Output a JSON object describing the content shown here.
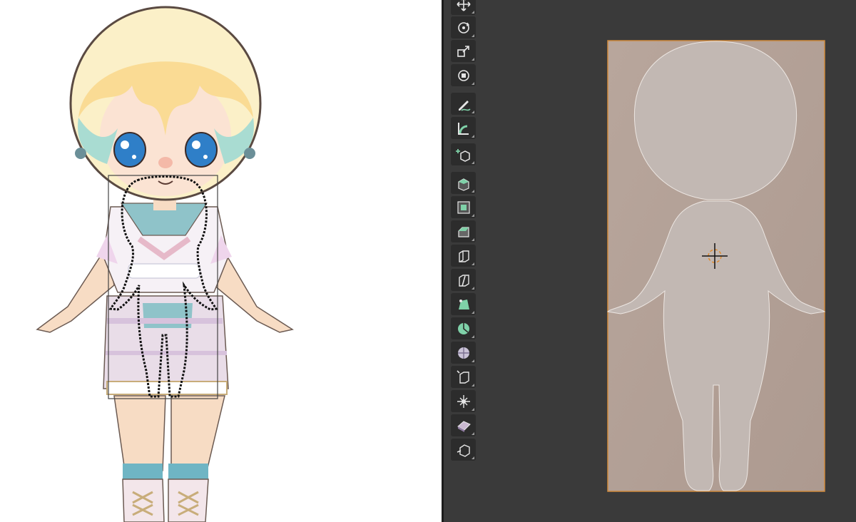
{
  "window": {
    "left_panel": "reference-image-canvas",
    "right_panel": "3d-viewport"
  },
  "colors": {
    "viewport_bg": "#3a3a3a",
    "toolbar_button_bg": "#2c2c2c",
    "tool_icon": "#e6e6e6",
    "tool_accent": "#7fd1a8",
    "reference_plane": "#b5a39a",
    "reference_plane_outline": "#d08a3c",
    "mesh_silhouette": "#c2b8b3",
    "cursor": "#e08a2c"
  },
  "toolbar": {
    "tools": [
      {
        "name": "move-icon"
      },
      {
        "name": "rotate-icon"
      },
      {
        "name": "scale-icon"
      },
      {
        "name": "transform-icon"
      },
      {
        "name": "annotate-icon"
      },
      {
        "name": "measure-icon"
      },
      {
        "name": "add-cube-icon"
      },
      {
        "name": "extrude-region-icon"
      },
      {
        "name": "inset-faces-icon"
      },
      {
        "name": "bevel-icon"
      },
      {
        "name": "loop-cut-icon"
      },
      {
        "name": "knife-icon"
      },
      {
        "name": "poly-build-icon"
      },
      {
        "name": "spin-icon"
      },
      {
        "name": "smooth-icon"
      },
      {
        "name": "edge-slide-icon"
      },
      {
        "name": "shrink-fatten-icon"
      },
      {
        "name": "shear-icon"
      },
      {
        "name": "rip-region-icon"
      }
    ]
  }
}
